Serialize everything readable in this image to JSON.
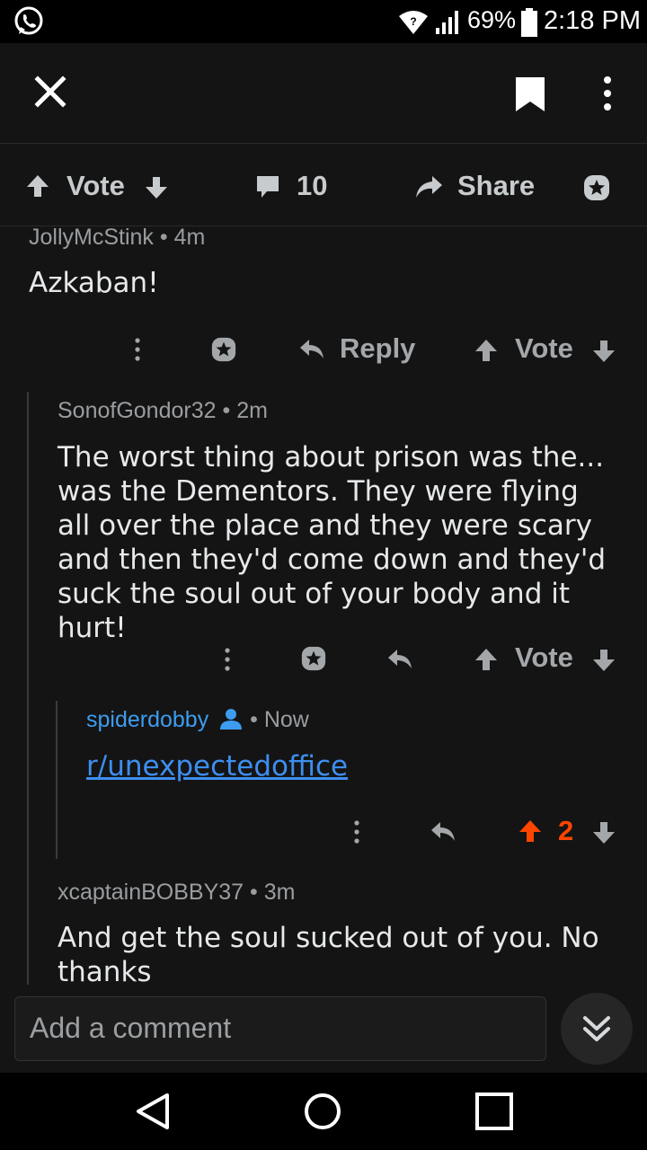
{
  "status_bar": {
    "battery_percent": "69%",
    "time": "2:18 PM"
  },
  "action_bar": {
    "vote_label": "Vote",
    "comment_count": "10",
    "share_label": "Share"
  },
  "comments": [
    {
      "author": "JollyMcStink",
      "age": "4m",
      "body": "Azkaban!",
      "reply_label": "Reply",
      "vote_label": "Vote"
    },
    {
      "author": "SonofGondor32",
      "age": "2m",
      "body": "The worst thing about prison was the... was the Dementors. They were flying all over the place and they were scary and then they'd come down and they'd suck the soul out of your body and it hurt!",
      "vote_label": "Vote"
    },
    {
      "author": "spiderdobby",
      "age": "Now",
      "body_link": "r/unexpectedoffice",
      "score": "2"
    },
    {
      "author": "xcaptainBOBBY37",
      "age": "3m",
      "body": "And get the soul sucked out of you. No thanks"
    }
  ],
  "composer": {
    "placeholder": "Add a comment"
  },
  "colors": {
    "background": "#141414",
    "upvote_active": "#ff4500",
    "link": "#3d8ef0"
  }
}
